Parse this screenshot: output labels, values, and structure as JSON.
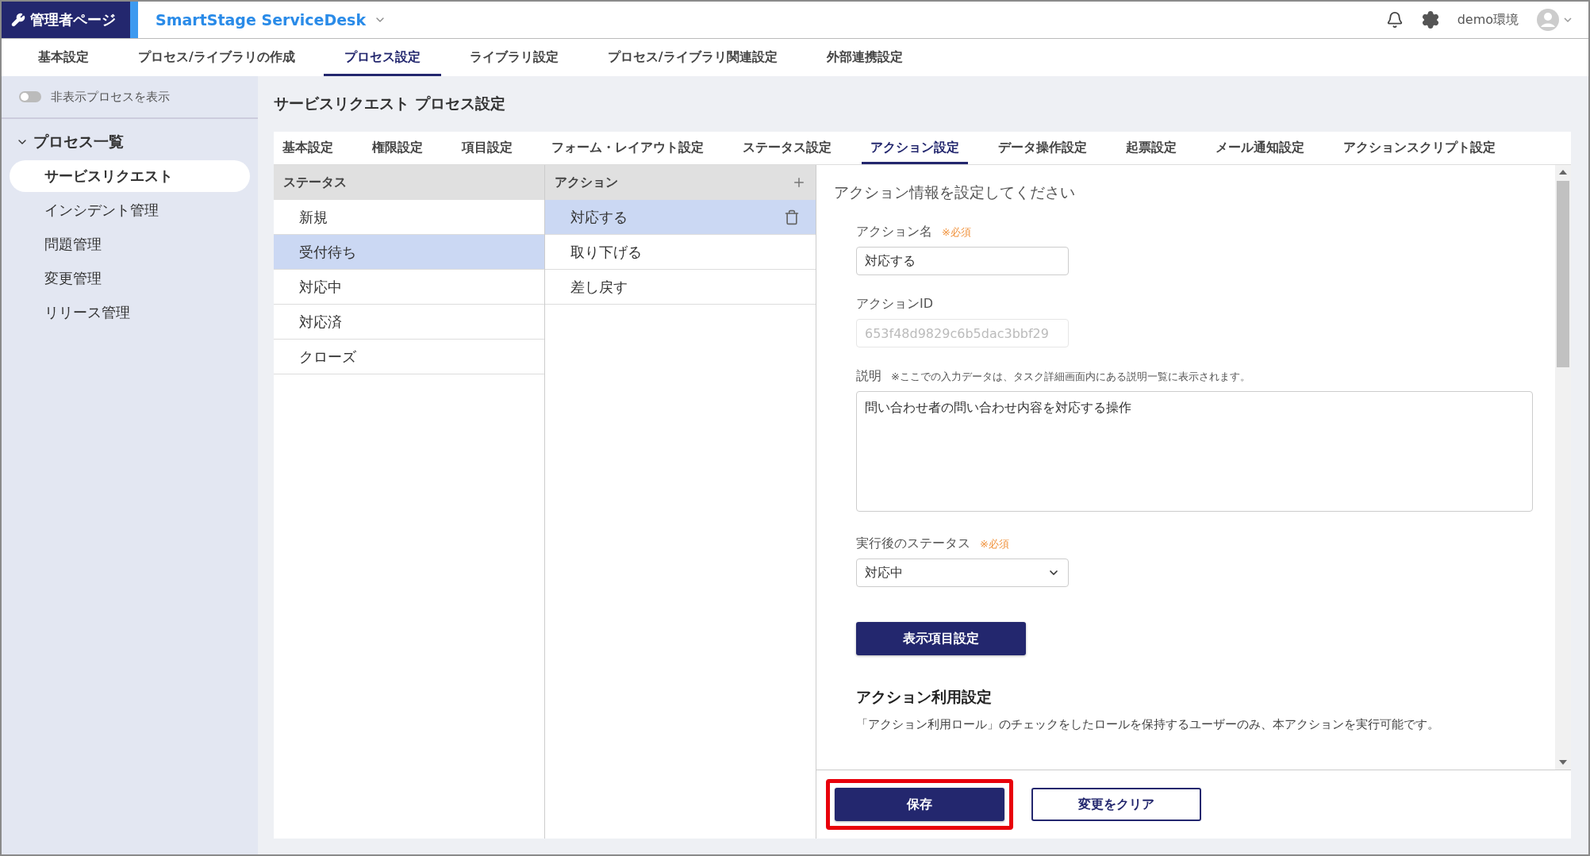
{
  "header": {
    "brand": "管理者ページ",
    "app_name": "SmartStage ServiceDesk",
    "environment": "demo環境"
  },
  "main_tabs": [
    {
      "label": "基本設定",
      "selected": false
    },
    {
      "label": "プロセス/ライブラリの作成",
      "selected": false
    },
    {
      "label": "プロセス設定",
      "selected": true
    },
    {
      "label": "ライブラリ設定",
      "selected": false
    },
    {
      "label": "プロセス/ライブラリ関連設定",
      "selected": false
    },
    {
      "label": "外部連携設定",
      "selected": false
    }
  ],
  "sidebar": {
    "toggle": {
      "label": "非表示プロセスを表示",
      "on": false
    },
    "section": {
      "title": "プロセス一覧",
      "expanded": true,
      "items": [
        {
          "label": "サービスリクエスト",
          "selected": true
        },
        {
          "label": "インシデント管理",
          "selected": false
        },
        {
          "label": "問題管理",
          "selected": false
        },
        {
          "label": "変更管理",
          "selected": false
        },
        {
          "label": "リリース管理",
          "selected": false
        }
      ]
    }
  },
  "page_title": "サービスリクエスト プロセス設定",
  "process_tabs": [
    {
      "label": "基本設定",
      "selected": false
    },
    {
      "label": "権限設定",
      "selected": false
    },
    {
      "label": "項目設定",
      "selected": false
    },
    {
      "label": "フォーム・レイアウト設定",
      "selected": false
    },
    {
      "label": "ステータス設定",
      "selected": false
    },
    {
      "label": "アクション設定",
      "selected": true
    },
    {
      "label": "データ操作設定",
      "selected": false
    },
    {
      "label": "起票設定",
      "selected": false
    },
    {
      "label": "メール通知設定",
      "selected": false
    },
    {
      "label": "アクションスクリプト設定",
      "selected": false
    }
  ],
  "status_column": {
    "header": "ステータス",
    "items": [
      {
        "label": "新規",
        "selected": false
      },
      {
        "label": "受付待ち",
        "selected": true
      },
      {
        "label": "対応中",
        "selected": false
      },
      {
        "label": "対応済",
        "selected": false
      },
      {
        "label": "クローズ",
        "selected": false
      }
    ]
  },
  "action_column": {
    "header": "アクション",
    "items": [
      {
        "label": "対応する",
        "selected": true
      },
      {
        "label": "取り下げる",
        "selected": false
      },
      {
        "label": "差し戻す",
        "selected": false
      }
    ]
  },
  "detail": {
    "heading": "アクション情報を設定してください",
    "fields": [
      {
        "kind": "text",
        "label": "アクション名",
        "note": "※必須",
        "value": "対応する"
      },
      {
        "kind": "readonly",
        "label": "アクションID",
        "value": "653f48d9829c6b5dac3bbf29"
      },
      {
        "kind": "textarea",
        "label": "説明",
        "note": "※ここでの入力データは、タスク詳細画面内にある説明一覧に表示されます。",
        "value": "問い合わせ者の問い合わせ内容を対応する操作"
      },
      {
        "kind": "select",
        "label": "実行後のステータス",
        "note": "※必須",
        "value": "対応中"
      }
    ],
    "display_button": "表示項目設定",
    "usage": {
      "title": "アクション利用設定",
      "description": "「アクション利用ロール」のチェックをしたロールを保持するユーザーのみ、本アクションを実行可能です。"
    }
  },
  "footer": {
    "buttons": [
      {
        "label": "保存",
        "kind": "primary",
        "highlighted": true
      },
      {
        "label": "変更をクリア",
        "kind": "secondary",
        "highlighted": false
      }
    ]
  }
}
